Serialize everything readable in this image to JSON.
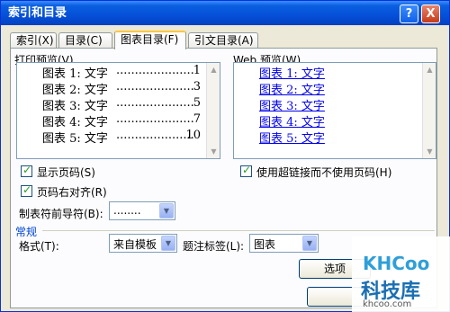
{
  "title": "索引和目录",
  "title_buttons": {
    "help": "?",
    "close": "X"
  },
  "tabs": [
    "索引(X)",
    "目录(C)",
    "图表目录(F)",
    "引文目录(A)"
  ],
  "print_preview": {
    "label": "打印预览(V)",
    "entries": [
      {
        "text": "图表 1: 文字",
        "dots": "...........................",
        "page": "1"
      },
      {
        "text": "图表 2: 文字",
        "dots": "...........................",
        "page": "3"
      },
      {
        "text": "图表 3: 文字",
        "dots": "...........................",
        "page": "5"
      },
      {
        "text": "图表 4: 文字",
        "dots": "...........................",
        "page": "7"
      },
      {
        "text": "图表 5: 文字",
        "dots": "...........................",
        "page": "10"
      }
    ]
  },
  "web_preview": {
    "label": "Web 预览(W)",
    "entries": [
      "图表 1: 文字",
      "图表 2: 文字",
      "图表 3: 文字",
      "图表 4: 文字",
      "图表 5: 文字"
    ]
  },
  "options": {
    "show_page_numbers": "显示页码(S)",
    "right_align_page_numbers": "页码右对齐(R)",
    "use_hyperlinks": "使用超链接而不使用页码(H)",
    "tab_leader_label": "制表符前导符(B):",
    "tab_leader_value": "........"
  },
  "general": {
    "group_label": "常规",
    "format_label": "格式(T):",
    "format_value": "来自模板",
    "caption_label": "题注标签(L):",
    "caption_value": "图表",
    "options_button": "选项"
  },
  "watermark": {
    "logo": "KHCoo",
    "name": "科技库",
    "url": "khcoo.com"
  }
}
